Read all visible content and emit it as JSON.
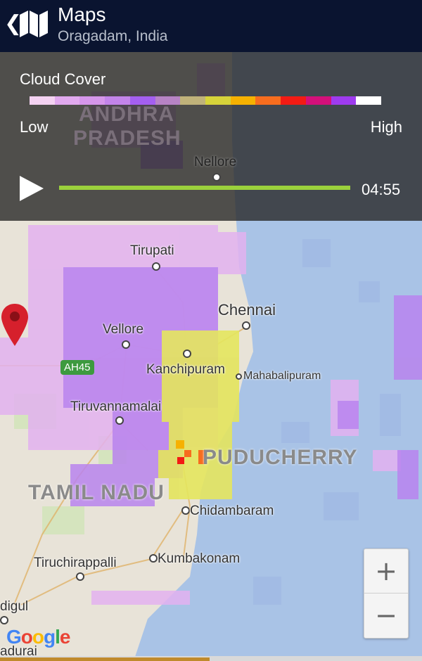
{
  "header": {
    "back_icon": "chevron-left-icon",
    "app_icon": "folded-map-icon",
    "title": "Maps",
    "subtitle": "Oragadam, India"
  },
  "panel": {
    "title": "Cloud Cover",
    "low_label": "Low",
    "high_label": "High",
    "legend_colors": [
      "#f4d2f2",
      "#e1a9ee",
      "#d596ea",
      "#c384ea",
      "#a45ff0",
      "#b783c5",
      "#c0b27a",
      "#d7d33a",
      "#f6b100",
      "#f76d1e",
      "#f31b14",
      "#d4107a",
      "#9e3bef",
      "#ffffff"
    ],
    "time": "04:55",
    "play_icon": "play-icon",
    "progress": 1.0,
    "progress_color": "#9bd13c"
  },
  "map": {
    "labels": {
      "andhra": "ANDHRA",
      "pradesh": "PRADESH",
      "nellore": "Nellore",
      "tirupati": "Tirupati",
      "chennai": "Chennai",
      "vellore": "Vellore",
      "kanchipuram": "Kanchipuram",
      "mahabalipuram": "Mahabalipuram",
      "tiruvannamalai": "Tiruvannamalai",
      "puducherry": "PUDUCHERRY",
      "tamil_nadu": "TAMIL NADU",
      "chidambaram": "Chidambaram",
      "tiruchirappalli": "Tiruchirappalli",
      "kumbakonam": "Kumbakonam",
      "dindigul": "digul",
      "madurai": "adurai",
      "highway": "AH45"
    },
    "pin_icon": "location-pin-icon",
    "zoom_in": "+",
    "zoom_out": "−",
    "attribution": "Google",
    "colors": {
      "land": "#e8e3d8",
      "sea": "#a9c3e6",
      "cloud_light": "#e6b4f0",
      "cloud_mid": "#b984ee",
      "cloud_dense": "#e2e35c",
      "pin": "#d6202c"
    }
  }
}
